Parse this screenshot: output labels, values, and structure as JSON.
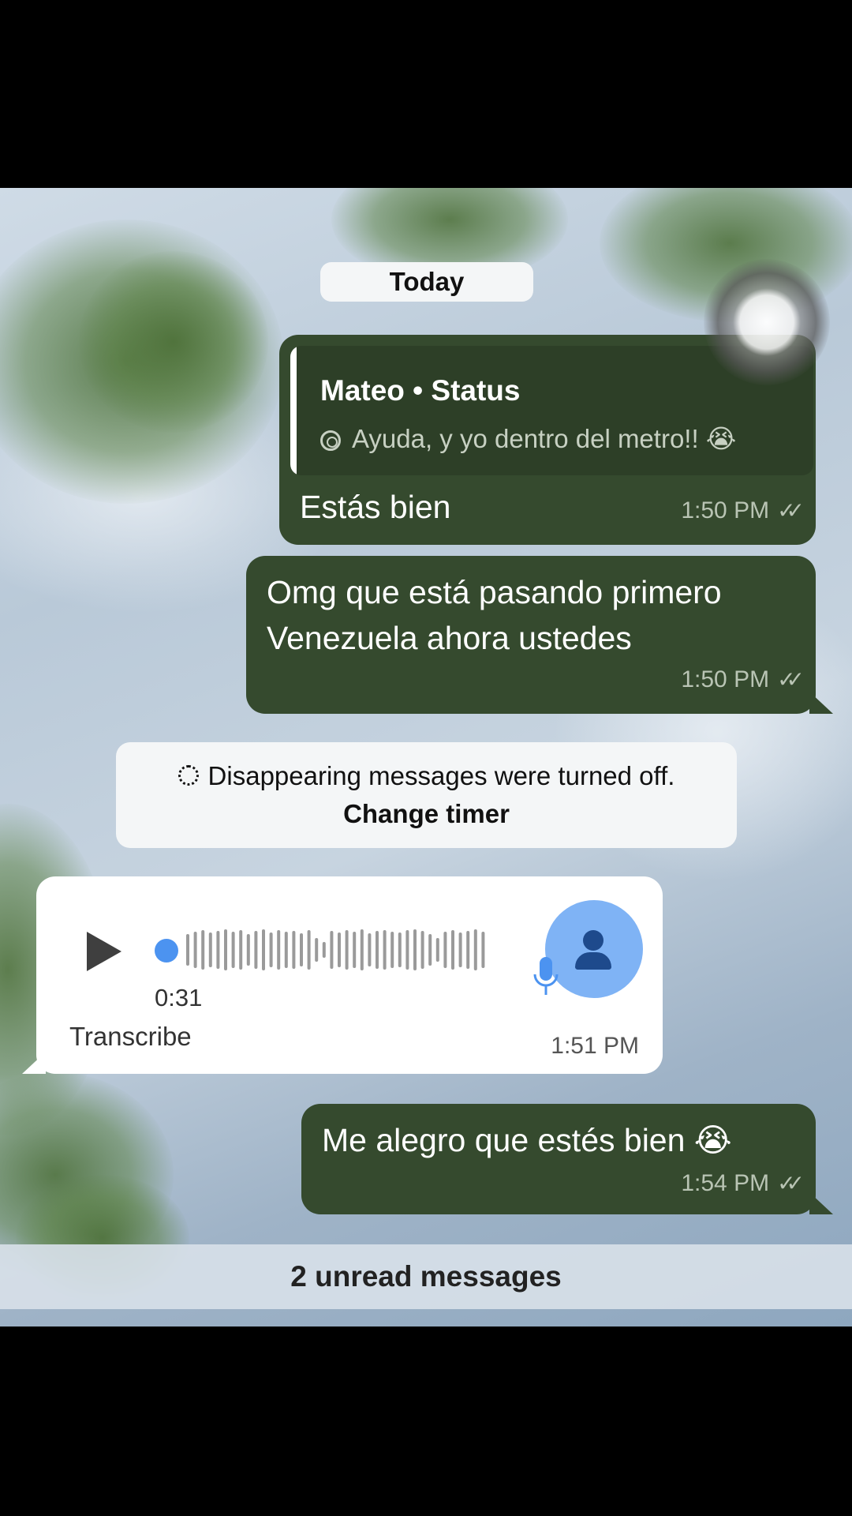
{
  "chat": {
    "date_divider": "Today",
    "messages": [
      {
        "reply": {
          "name": "Mateo • Status",
          "text": "Ayuda, y yo dentro del metro!! 😭"
        },
        "text": "Estás bien",
        "time": "1:50 PM"
      },
      {
        "lines": [
          "Omg que está pasando primero",
          "Venezuela ahora ustedes"
        ],
        "time": "1:50 PM"
      }
    ],
    "system_notice": {
      "text": "Disappearing messages were turned off.",
      "action": "Change timer"
    },
    "voice_message": {
      "duration": "0:31",
      "transcribe_label": "Transcribe",
      "time": "1:51 PM",
      "progress": 0
    },
    "last_message": {
      "text": "Me alegro que estés bien 😭",
      "time": "1:54 PM"
    },
    "unread_banner": "2 unread messages"
  },
  "icons": {
    "status_icon": "status-ring-icon",
    "read_receipt": "double-check-icon",
    "timer": "timer-icon",
    "play": "play-icon",
    "mic": "microphone-icon",
    "avatar": "person-icon"
  },
  "colors": {
    "outgoing_bubble": "#354a2e",
    "incoming_bubble": "#ffffff",
    "accent_blue": "#4c93f0"
  }
}
